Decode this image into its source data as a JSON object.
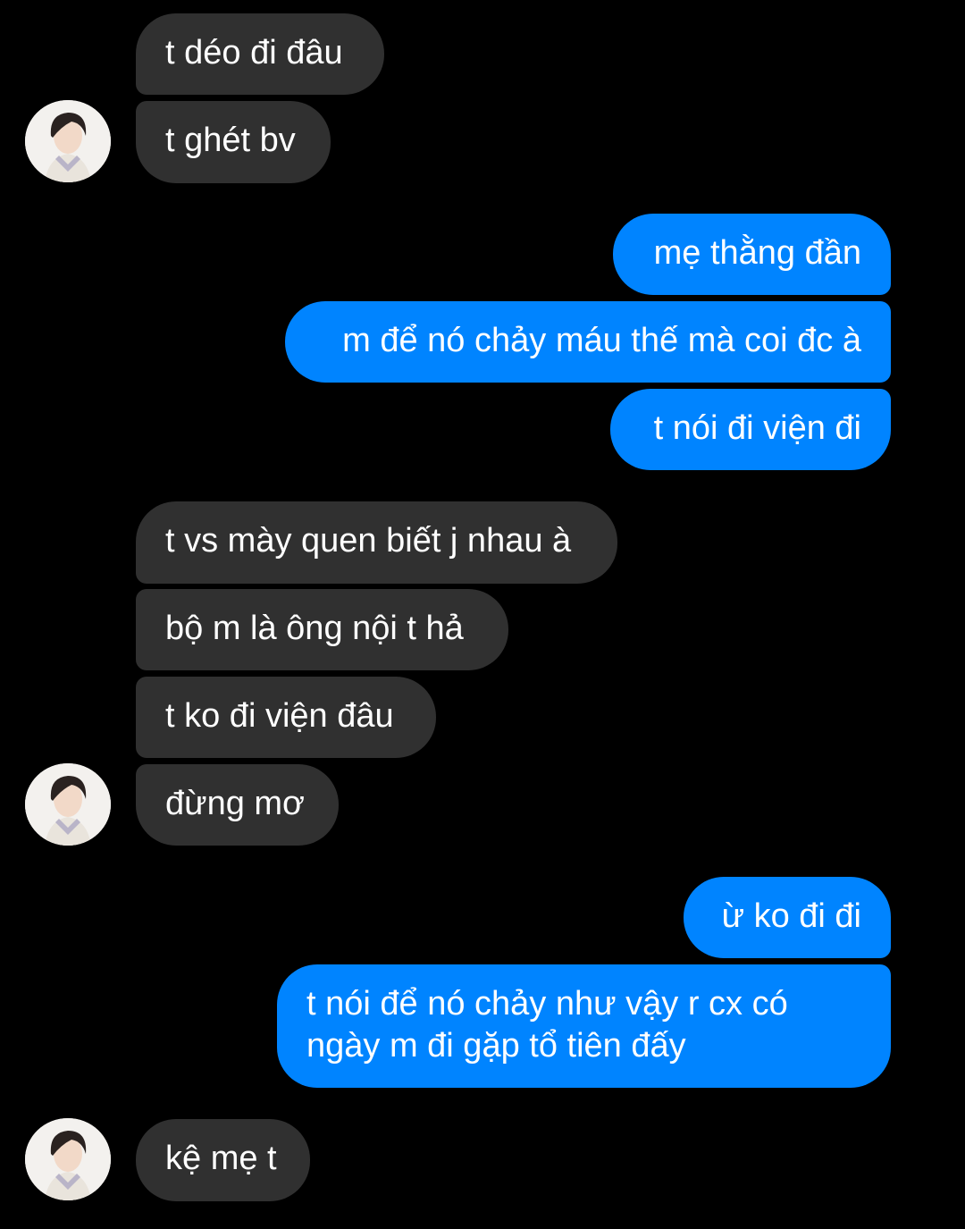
{
  "theme": {
    "background": "#000000",
    "incoming_bubble": "#303030",
    "outgoing_bubble": "#0084ff",
    "text": "#ffffff"
  },
  "messages": [
    {
      "side": "incoming",
      "text": "t déo đi đâu"
    },
    {
      "side": "incoming",
      "text": "t ghét bv",
      "avatar": "contact-avatar-icon"
    },
    {
      "side": "outgoing",
      "text": "mẹ thằng đần"
    },
    {
      "side": "outgoing",
      "text": "m để nó chảy máu thế mà coi đc à"
    },
    {
      "side": "outgoing",
      "text": "t nói đi viện đi"
    },
    {
      "side": "incoming",
      "text": "t vs mày quen biết j nhau à"
    },
    {
      "side": "incoming",
      "text": "bộ m là ông nội t hả"
    },
    {
      "side": "incoming",
      "text": "t ko đi viện đâu"
    },
    {
      "side": "incoming",
      "text": "đừng mơ",
      "avatar": "contact-avatar-icon"
    },
    {
      "side": "outgoing",
      "text": "ừ ko đi đi"
    },
    {
      "side": "outgoing",
      "text": "t nói để nó chảy như vậy r cx có\nngày m đi gặp tổ tiên đấy"
    },
    {
      "side": "incoming",
      "text": "kệ mẹ t",
      "avatar": "contact-avatar-icon"
    }
  ]
}
